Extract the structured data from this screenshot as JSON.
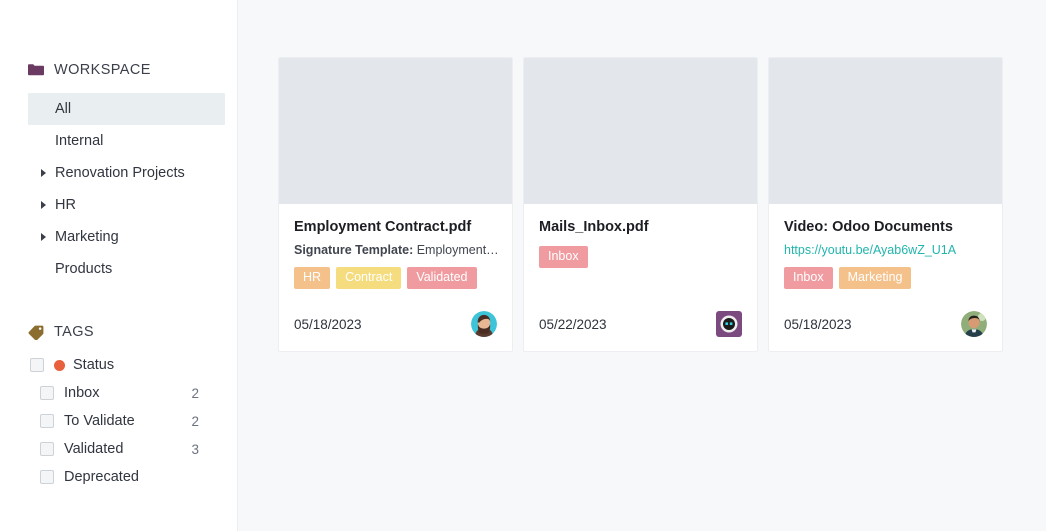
{
  "sidebar": {
    "workspace": {
      "icon": "folder-icon",
      "icon_color": "#6b3a62",
      "title": "WORKSPACE",
      "items": [
        {
          "label": "All",
          "selected": true,
          "caret": false
        },
        {
          "label": "Internal",
          "selected": false,
          "caret": false
        },
        {
          "label": "Renovation Projects",
          "selected": false,
          "caret": true
        },
        {
          "label": "HR",
          "selected": false,
          "caret": true
        },
        {
          "label": "Marketing",
          "selected": false,
          "caret": true
        },
        {
          "label": "Products",
          "selected": false,
          "caret": false
        }
      ]
    },
    "tags": {
      "icon": "tag-icon",
      "icon_color": "#8c6d30",
      "title": "TAGS",
      "groups": [
        {
          "label": "Status",
          "dot_color": "#e8603c",
          "checked": false,
          "count": "",
          "children": [
            {
              "label": "Inbox",
              "count": "2",
              "checked": false
            },
            {
              "label": "To Validate",
              "count": "2",
              "checked": false
            },
            {
              "label": "Validated",
              "count": "3",
              "checked": false
            },
            {
              "label": "Deprecated",
              "count": "",
              "checked": false
            }
          ]
        }
      ]
    }
  },
  "main": {
    "cards": [
      {
        "title": "Employment Contract.pdf",
        "subtitle_bold": "Signature Template:",
        "subtitle_rest": " Employment…",
        "url": "",
        "chips": [
          {
            "label": "HR",
            "color": "#f5c18a"
          },
          {
            "label": "Contract",
            "color": "#f5dd7f"
          },
          {
            "label": "Validated",
            "color": "#f09ba0"
          }
        ],
        "date": "05/18/2023",
        "avatar": "avatar-woman-brunette"
      },
      {
        "title": "Mails_Inbox.pdf",
        "subtitle_bold": "",
        "subtitle_rest": "",
        "url": "",
        "chips": [
          {
            "label": "Inbox",
            "color": "#f09ba0"
          }
        ],
        "date": "05/22/2023",
        "avatar": "avatar-odoobot"
      },
      {
        "title": "Video: Odoo Documents",
        "subtitle_bold": "",
        "subtitle_rest": "",
        "url": "https://youtu.be/Ayab6wZ_U1A",
        "chips": [
          {
            "label": "Inbox",
            "color": "#f09ba0"
          },
          {
            "label": "Marketing",
            "color": "#f5c18a"
          }
        ],
        "date": "05/18/2023",
        "avatar": "avatar-man-dark-hair"
      }
    ]
  },
  "colors": {
    "page_background": "#f7f8fa",
    "sidebar_background": "#ffffff",
    "selected_item": "#e9eff1",
    "thumbnail_placeholder": "#e3e6ea",
    "link_teal": "#21b5ac"
  }
}
